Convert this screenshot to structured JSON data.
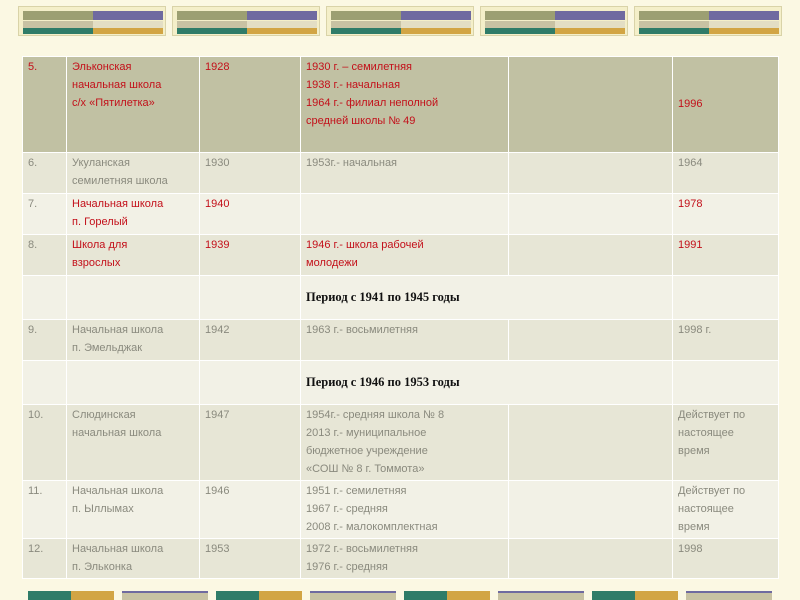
{
  "rows": [
    {
      "num": "5.",
      "name": [
        "Эльконская",
        "начальная школа",
        "с/х «Пятилетка»"
      ],
      "year": "1928",
      "history": [
        "1930 г. – семилетняя",
        "1938 г.- начальная",
        "1964 г.- филиал неполной",
        "средней школы № 49"
      ],
      "closed": "1996"
    },
    {
      "num": "6.",
      "name": [
        "Укуланская",
        "семилетняя школа"
      ],
      "year": "1930",
      "history": [
        "1953г.- начальная"
      ],
      "closed": "1964"
    },
    {
      "num": "7.",
      "name": [
        "Начальная школа",
        "п. Горелый"
      ],
      "year": "1940",
      "history": [],
      "closed": "1978"
    },
    {
      "num": "8.",
      "name": [
        "Школа для",
        "взрослых"
      ],
      "year": "1939",
      "history": [
        "1946 г.- школа рабочей",
        "молодежи"
      ],
      "closed": "1991"
    },
    {
      "period": "Период с 1941 по 1945 годы"
    },
    {
      "num": "9.",
      "name": [
        "Начальная школа",
        " п. Эмельджак"
      ],
      "year": "1942",
      "history": [
        "1963 г.- восьмилетняя"
      ],
      "closed": "1998 г."
    },
    {
      "period": "Период с 1946 по 1953 годы"
    },
    {
      "num": "10.",
      "name": [
        "Слюдинская",
        "начальная школа"
      ],
      "year": "1947",
      "history": [
        "1954г.- средняя школа № 8",
        "2013 г.- муниципальное",
        "бюджетное учреждение",
        "«СОШ № 8 г. Томмота»"
      ],
      "closed": [
        "Действует по",
        "настоящее",
        "время"
      ]
    },
    {
      "num": "11.",
      "name": [
        "Начальная школа",
        " п. Ыллымах"
      ],
      "year": "1946",
      "history": [
        "1951 г.- семилетняя",
        "1967 г.- средняя",
        "2008 г.- малокомплектная"
      ],
      "closed": [
        "Действует по",
        "настоящее",
        "время"
      ]
    },
    {
      "num": "12.",
      "name": [
        "Начальная школа",
        "п. Эльконка"
      ],
      "year": "1953",
      "history": [
        "1972 г.- восьмилетняя",
        "1976 г.- средняя"
      ],
      "closed": "1998"
    }
  ],
  "colors": {
    "header_row": "#c1c1a3",
    "row_dark": "#e7e6d6",
    "row_light": "#f2f1e6",
    "red_text": "#c3101a",
    "gray_text": "#8a8a7e"
  }
}
